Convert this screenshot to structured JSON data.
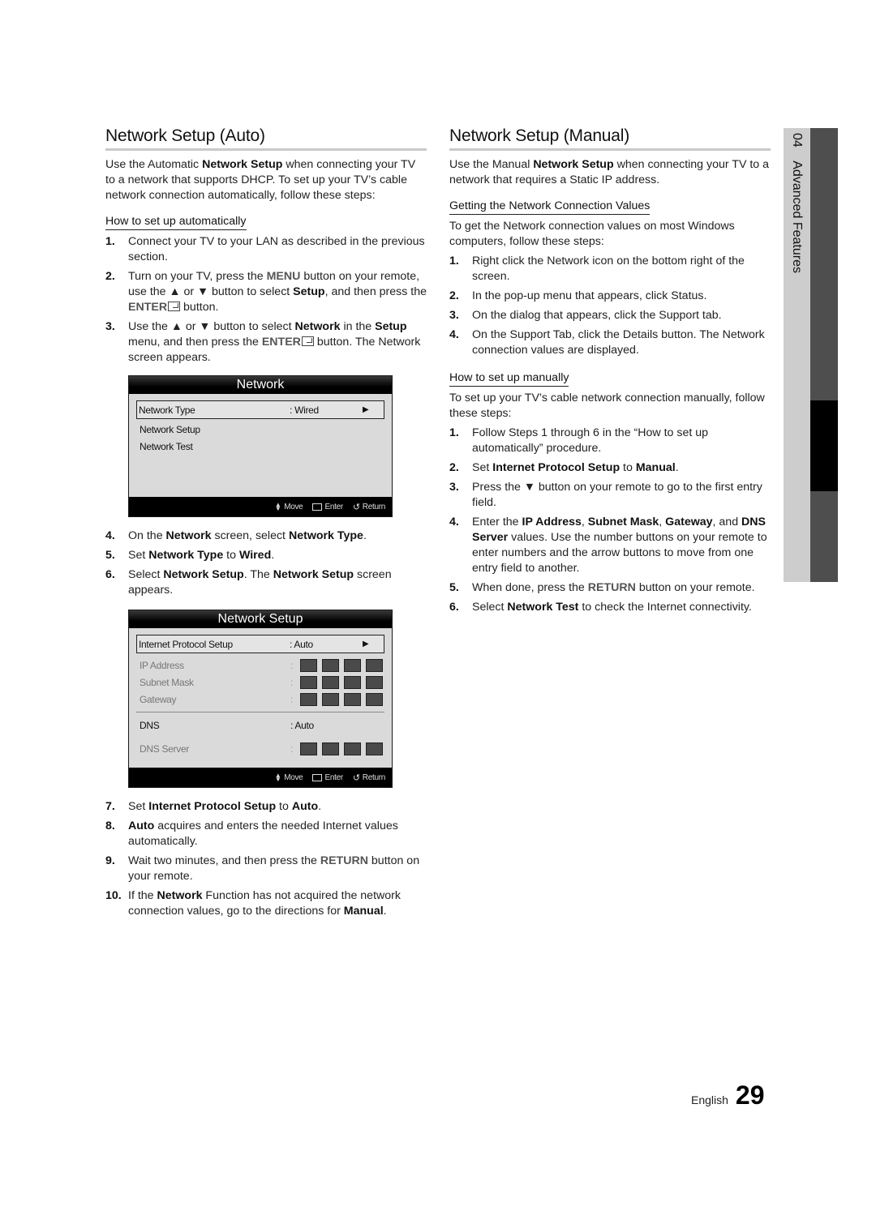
{
  "left": {
    "title": "Network Setup (Auto)",
    "intro": [
      {
        "t": "Use the Automatic "
      },
      {
        "b": "Network Setup"
      },
      {
        "t": " when connecting your TV to a network that supports DHCP. To set up your TV’s cable network connection automatically, follow these steps:"
      }
    ],
    "subhead": "How to set up automatically",
    "steps_a": [
      {
        "num": "1.",
        "parts": [
          {
            "t": "Connect your TV to your LAN as described in the previous section."
          }
        ]
      },
      {
        "num": "2.",
        "parts": [
          {
            "t": "Turn on your TV, press the "
          },
          {
            "g": "MENU"
          },
          {
            "t": " button on your remote, use the ▲ or ▼ button to select "
          },
          {
            "b": "Setup"
          },
          {
            "t": ", and then press the "
          },
          {
            "g": "ENTER"
          },
          {
            "e": "enter-icon"
          },
          {
            "t": " button."
          }
        ]
      },
      {
        "num": "3.",
        "parts": [
          {
            "t": "Use the ▲ or ▼ button to select "
          },
          {
            "b": "Network"
          },
          {
            "t": " in the "
          },
          {
            "b": "Setup"
          },
          {
            "t": " menu, and then press the "
          },
          {
            "g": "ENTER"
          },
          {
            "e": "enter-icon"
          },
          {
            "t": " button. The Network screen appears."
          }
        ]
      }
    ],
    "osd_network": {
      "title": "Network",
      "rows": [
        {
          "label": "Network Type",
          "value": ": Wired",
          "arrow": "▶",
          "selected": true
        },
        {
          "label": "Network Setup"
        },
        {
          "label": "Network Test"
        }
      ],
      "footer": {
        "move": "Move",
        "enter": "Enter",
        "return": "Return"
      }
    },
    "steps_b": [
      {
        "num": "4.",
        "parts": [
          {
            "t": "On the "
          },
          {
            "b": "Network"
          },
          {
            "t": " screen, select "
          },
          {
            "b": "Network Type"
          },
          {
            "t": "."
          }
        ]
      },
      {
        "num": "5.",
        "parts": [
          {
            "t": "Set "
          },
          {
            "b": "Network Type"
          },
          {
            "t": " to "
          },
          {
            "b": "Wired"
          },
          {
            "t": "."
          }
        ]
      },
      {
        "num": "6.",
        "parts": [
          {
            "t": "Select "
          },
          {
            "b": "Network Setup"
          },
          {
            "t": ". The "
          },
          {
            "b": "Network Setup"
          },
          {
            "t": " screen appears."
          }
        ]
      }
    ],
    "osd_setup": {
      "title": "Network Setup",
      "ips": {
        "label": "Internet Protocol Setup",
        "value": ": Auto",
        "arrow": "▶"
      },
      "fields": [
        "IP Address",
        "Subnet Mask",
        "Gateway"
      ],
      "dns": {
        "label": "DNS",
        "value": ": Auto"
      },
      "dns_server": "DNS Server",
      "colon": ":",
      "footer": {
        "move": "Move",
        "enter": "Enter",
        "return": "Return"
      }
    },
    "steps_c": [
      {
        "num": "7.",
        "parts": [
          {
            "t": "Set "
          },
          {
            "b": "Internet Protocol Setup"
          },
          {
            "t": " to "
          },
          {
            "b": "Auto"
          },
          {
            "t": "."
          }
        ]
      },
      {
        "num": "8.",
        "parts": [
          {
            "b": "Auto"
          },
          {
            "t": " acquires and enters the needed Internet values automatically."
          }
        ]
      },
      {
        "num": "9.",
        "parts": [
          {
            "t": "Wait two minutes, and then press the "
          },
          {
            "g": "RETURN"
          },
          {
            "t": " button on your remote."
          }
        ]
      },
      {
        "num": "10.",
        "parts": [
          {
            "t": "If the "
          },
          {
            "b": "Network"
          },
          {
            "t": " Function has not acquired the network connection values, go to the directions for "
          },
          {
            "b": "Manual"
          },
          {
            "t": "."
          }
        ]
      }
    ]
  },
  "right": {
    "title": "Network Setup (Manual)",
    "intro": [
      {
        "t": "Use the Manual "
      },
      {
        "b": "Network Setup"
      },
      {
        "t": " when connecting your TV to a network that requires a Static IP address."
      }
    ],
    "subhead1": "Getting the Network Connection Values",
    "para1": "To get the Network connection values on most Windows computers, follow these steps:",
    "steps1": [
      {
        "num": "1.",
        "parts": [
          {
            "t": "Right click the Network icon on the bottom right of the screen."
          }
        ]
      },
      {
        "num": "2.",
        "parts": [
          {
            "t": "In the pop-up menu that appears, click Status."
          }
        ]
      },
      {
        "num": "3.",
        "parts": [
          {
            "t": "On the dialog that appears, click the Support tab."
          }
        ]
      },
      {
        "num": "4.",
        "parts": [
          {
            "t": "On the Support Tab, click the Details button. The Network connection values are displayed."
          }
        ]
      }
    ],
    "subhead2": "How to set up manually",
    "para2": "To set up your TV’s cable network connection manually, follow these steps:",
    "steps2": [
      {
        "num": "1.",
        "parts": [
          {
            "t": "Follow Steps 1 through 6 in the “How to set up automatically” procedure."
          }
        ]
      },
      {
        "num": "2.",
        "parts": [
          {
            "t": "Set "
          },
          {
            "b": "Internet Protocol Setup"
          },
          {
            "t": " to "
          },
          {
            "b": "Manual"
          },
          {
            "t": "."
          }
        ]
      },
      {
        "num": "3.",
        "parts": [
          {
            "t": "Press the ▼ button on your remote to go to the first entry field."
          }
        ]
      },
      {
        "num": "4.",
        "parts": [
          {
            "t": "Enter the "
          },
          {
            "b": "IP Address"
          },
          {
            "t": ", "
          },
          {
            "b": "Subnet Mask"
          },
          {
            "t": ", "
          },
          {
            "b": "Gateway"
          },
          {
            "t": ", and "
          },
          {
            "b": "DNS Server"
          },
          {
            "t": " values. Use the number buttons on your remote to enter numbers and the arrow buttons to move from one entry field to another."
          }
        ]
      },
      {
        "num": "5.",
        "parts": [
          {
            "t": "When done, press the "
          },
          {
            "g": "RETURN"
          },
          {
            "t": " button on your remote."
          }
        ]
      },
      {
        "num": "6.",
        "parts": [
          {
            "t": "Select "
          },
          {
            "b": "Network Test"
          },
          {
            "t": " to check the Internet connectivity."
          }
        ]
      }
    ]
  },
  "side_tab": {
    "chapter": "04",
    "label": "Advanced Features"
  },
  "footer": {
    "language": "English",
    "page": "29"
  }
}
